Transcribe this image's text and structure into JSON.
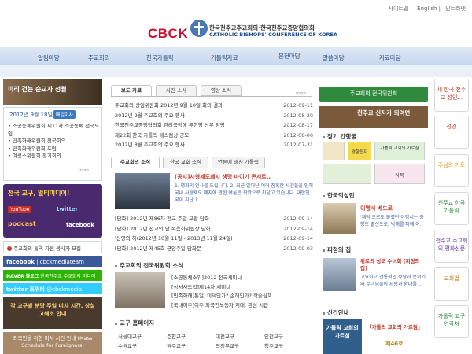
{
  "top_links": [
    "사이트맵",
    "English",
    "인트라넷"
  ],
  "logo": {
    "word": "CBCK",
    "kr": "한국천주교주교회의·한국천주교중앙협의회",
    "en": "CATHOLIC BISHOPS' CONFERENCE OF KOREA"
  },
  "nav": [
    "알림마당",
    "주교회의",
    "한국가톨릭",
    "가톨릭자료",
    "문헌마당",
    "말씀마당",
    "자료마당"
  ],
  "left": {
    "banner": "미리 걷는 순교자 성월",
    "date": "2012년 9월 18일",
    "date_badge": "매일미사",
    "items": [
      "소공동체위원회 제11차 소공동체 전국모임",
      "민족화해위원회 전국회의",
      "민족화해위원회 포럼",
      "여성소위원회 정기회의"
    ],
    "more": "more",
    "promo": "전국 교구, 멀티미디어!",
    "promo_labels": [
      "YouTube",
      "twitter",
      "podcast",
      "facebook"
    ],
    "notice": "주교회의 통역 자원 봉사자 모집",
    "sns": [
      "facebook",
      "cbckmediateam",
      "NAVER 블로그",
      "한국천주교 주교회의 미디어팀",
      "twitter 트위터",
      "cbckmedia"
    ],
    "dark_banner": "각 교구별 분당 주일 미사 시간, 상설고해소 안내",
    "foreign": "외국인을 위한 미사 시간 안내 (Mass Schedule for Foreigners)"
  },
  "center": {
    "tabs": [
      "보도 자료",
      "사진 소식",
      "영상 소식"
    ],
    "more": "more",
    "news": [
      {
        "t": "주교회의 상임위원회 2012년 9월 10일 회의 결과",
        "d": "2012-09-11"
      },
      {
        "t": "2012년 9월 주교회의 주요 행사",
        "d": "2012-08-30"
      },
      {
        "t": "한국천주교중앙협의회 관리국장에 류한영 신부 임명",
        "d": "2012-08-17"
      },
      {
        "t": "제22회 한국 가톨릭 매스컴상 공모",
        "d": "2012-08-06"
      },
      {
        "t": "2012년 8월 주교회의 주요 행사",
        "d": "2012-07-31"
      }
    ],
    "tabs2": [
      "주교회의 소식",
      "한국 교회 소식",
      "언론에 비친 가톨릭"
    ],
    "feature_title": "[공지]사형제도폐지 생명 마이기 콘서트..",
    "feature_body": "1. 평화의 인사를 드립니다. 2. 최근 일어난 여러 참혹한 사건들을 인해 국내 사형제도 폐지에 관한 여론은 최악으로 치닫고 있습니다. 대한민국이 지난 1",
    "news2": [
      {
        "t": "[담화] 2012년 제86차 전교 주일 교황 담화",
        "d": "2012-09-14"
      },
      {
        "t": "[담화] 2012년 전교의 달 복음화위원장 담화",
        "d": "2012-09-14"
      },
      {
        "t": "'신앙의 해(2012년 10월 11일 - 2013년 11월 24일)",
        "d": "2012-09-14"
      },
      {
        "t": "[담화] 2012년 제45회 군인주일 담화문",
        "d": "2012-09-03"
      }
    ],
    "committee_title": "주교회의 전국위원회 소식",
    "committee": [
      "[소공동체소위]2012 전국세미나",
      "[성서사도직]제14차 세미나",
      "[민족화해]통일, 미덕인가? 손해인가? 학술심포",
      "[국내이주]이주 외국인노동자 지대, 관심 시급"
    ],
    "dio_title": "교구 홈페이지",
    "dioceses": [
      "서울대교구",
      "춘천교구",
      "대전교구",
      "인천교구",
      "수원교구",
      "원주교구",
      "의정부교구",
      "청주교구"
    ]
  },
  "right": {
    "btn1": "주교회의 전국위원회",
    "btn2": "천주교 신자가 되려면",
    "pub_title": "정기 간행물",
    "pubs": [
      "경향잡지",
      "가톨릭 교회의 가르침",
      "",
      "사목"
    ],
    "saints_title": "한국의성인",
    "saint_name": "이명서 베드로",
    "saint_desc": "'재덕'으로도 불렸던 이명서는 충청도 출신으로, 박해를 피해 여..",
    "room_title": "피정의 집",
    "room_name": "위로의 성모 수녀회 (피정의 집)",
    "room_desc": "고요하고 간통적인 성당과 분위기와 수녀님들의 사랑과 환대를 ..",
    "book_title": "신간안내",
    "book_cover": "가톨릭 교회의 가르침",
    "book_text": "「가톨릭 교회의 가르침」",
    "book_num": "제46호"
  },
  "side": [
    "새 한국 천주교 성인...",
    "성경",
    "주님의 기도",
    "천주교 한국 가톨릭",
    "천주교 주교회의 평화신문",
    "교회법",
    "가톨릭 교구 연락처"
  ]
}
